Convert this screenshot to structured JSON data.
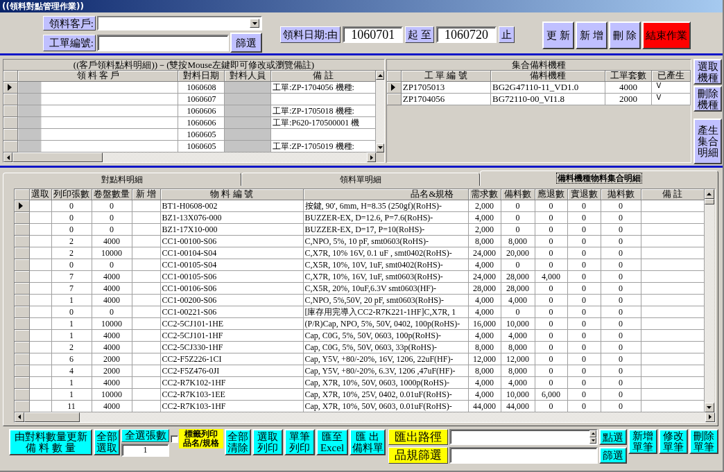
{
  "window": {
    "title": "((領料對點管理作業))"
  },
  "filters": {
    "customer": {
      "label": "領料客戶:"
    },
    "work_order": {
      "label": "工單編號:"
    },
    "filter_button": "篩選",
    "date_range": {
      "label": "領料日期:由",
      "from": "1060701",
      "between": "起 至",
      "to": "1060720",
      "end": "止"
    }
  },
  "toolbar": [
    {
      "label": "更 新",
      "kind": "normal"
    },
    {
      "label": "新 增",
      "kind": "normal"
    },
    {
      "label": "刪 除",
      "kind": "normal"
    },
    {
      "label": "結束作業",
      "kind": "danger"
    }
  ],
  "pick_table": {
    "title": "((客戶領料點料明細))－(雙按Mouse左鍵即可修改或瀏覽備註)",
    "columns": [
      "領 料 客 戶",
      "對料日期",
      "對料人員",
      "備 註"
    ],
    "rows": [
      {
        "selected": true,
        "masked": true,
        "date": "1060608",
        "remark": "工單:ZP-1704056 機種:"
      },
      {
        "selected": false,
        "masked": true,
        "date": "1060607"
      },
      {
        "selected": false,
        "masked": true,
        "date": "1060606",
        "remark": "工單:ZP-1705018 機種:"
      },
      {
        "selected": false,
        "masked": true,
        "date": "1060606",
        "remark": "工單:P620-170500001 機"
      },
      {
        "selected": false,
        "masked": true,
        "date": "1060605"
      },
      {
        "selected": false,
        "masked": true,
        "date": "1060605",
        "remark": "工單:ZP-1705019 機種:"
      }
    ]
  },
  "model_table": {
    "title": "集合備料機種",
    "columns": [
      "工 單 編 號",
      "備料機種",
      "工單套數",
      "已產生"
    ],
    "rows": [
      {
        "selected": true,
        "work_order": "ZP1705013",
        "model": "BG2G47110-11_VD1.0",
        "sets": "4000",
        "generated": "V"
      },
      {
        "selected": false,
        "work_order": "ZP1704056",
        "model": "BG72110-00_VI1.8",
        "sets": "2000",
        "generated": "V"
      }
    ]
  },
  "model_buttons": [
    "選取機種",
    "刪除機種",
    "產生集合明細"
  ],
  "tabs": [
    {
      "label": "對點料明細",
      "selected": false
    },
    {
      "label": "領料單明細",
      "selected": false
    },
    {
      "label": "備料機種物料集合明細",
      "selected": true
    }
  ],
  "detail_table": {
    "columns": [
      "選取",
      "列印張數",
      "卷盤數量",
      "新 增",
      "物 料 編 號",
      "品名&規格",
      "需求數",
      "備料數",
      "應退數",
      "實退數",
      "拋料數",
      "備 註"
    ],
    "rows": [
      {
        "selected": true,
        "print_count": "0",
        "reel_qty": "0",
        "part_no": "BT1-H0608-002",
        "name_spec": "按鍵, 90', 6mm, H=8.35 (250gf)(RoHS)-",
        "required": "2,000",
        "prepared": "0",
        "to_return": "0",
        "returned": "0",
        "scrapped": "0"
      },
      {
        "selected": false,
        "print_count": "0",
        "reel_qty": "0",
        "part_no": "BZ1-13X076-000",
        "name_spec": "BUZZER-EX, D=12.6, P=7.6(RoHS)-",
        "required": "4,000",
        "prepared": "0",
        "to_return": "0",
        "returned": "0",
        "scrapped": "0"
      },
      {
        "selected": false,
        "print_count": "0",
        "reel_qty": "0",
        "part_no": "BZ1-17X10-000",
        "name_spec": "BUZZER-EX, D=17, P=10(RoHS)-",
        "required": "2,000",
        "prepared": "0",
        "to_return": "0",
        "returned": "0",
        "scrapped": "0"
      },
      {
        "selected": false,
        "print_count": "2",
        "reel_qty": "4000",
        "part_no": "CC1-00100-S06",
        "name_spec": "C,NPO, 5%, 10 pF, smt0603(RoHS)-",
        "required": "8,000",
        "prepared": "8,000",
        "to_return": "0",
        "returned": "0",
        "scrapped": "0"
      },
      {
        "selected": false,
        "print_count": "2",
        "reel_qty": "10000",
        "part_no": "CC1-00104-S04",
        "name_spec": "C,X7R, 10% 16V, 0.1 uF , smt0402(RoHS)-",
        "required": "24,000",
        "prepared": "20,000",
        "to_return": "0",
        "returned": "0",
        "scrapped": "0"
      },
      {
        "selected": false,
        "print_count": "0",
        "reel_qty": "0",
        "part_no": "CC1-00105-S04",
        "name_spec": "C,X5R, 10%, 10V, 1uF, smt0402(RoHS)-",
        "required": "4,000",
        "prepared": "0",
        "to_return": "0",
        "returned": "0",
        "scrapped": "0"
      },
      {
        "selected": false,
        "print_count": "7",
        "reel_qty": "4000",
        "part_no": "CC1-00105-S06",
        "name_spec": "C,X7R, 10%, 16V, 1uF, smt0603(RoHS)-",
        "required": "24,000",
        "prepared": "28,000",
        "to_return": "4,000",
        "returned": "0",
        "scrapped": "0"
      },
      {
        "selected": false,
        "print_count": "7",
        "reel_qty": "4000",
        "part_no": "CC1-00106-S06",
        "name_spec": "C,X5R, 20%, 10uF,6.3V smt0603(HF)-",
        "required": "28,000",
        "prepared": "28,000",
        "to_return": "0",
        "returned": "0",
        "scrapped": "0"
      },
      {
        "selected": false,
        "print_count": "1",
        "reel_qty": "4000",
        "part_no": "CC1-00200-S06",
        "name_spec": "C,NPO, 5%,50V, 20 pF, smt0603(RoHS)-",
        "required": "4,000",
        "prepared": "4,000",
        "to_return": "0",
        "returned": "0",
        "scrapped": "0"
      },
      {
        "selected": false,
        "print_count": "0",
        "reel_qty": "0",
        "part_no": "CC1-00221-S06",
        "name_spec": "[庫存用完導入CC2-R7K221-1HF]C,X7R, 1",
        "required": "4,000",
        "prepared": "0",
        "to_return": "0",
        "returned": "0",
        "scrapped": "0"
      },
      {
        "selected": false,
        "print_count": "1",
        "reel_qty": "10000",
        "part_no": "CC2-5CJ101-1HE",
        "name_spec": "(P/R)Cap, NPO, 5%, 50V, 0402, 100p(RoHS)-",
        "required": "16,000",
        "prepared": "10,000",
        "to_return": "0",
        "returned": "0",
        "scrapped": "0"
      },
      {
        "selected": false,
        "print_count": "1",
        "reel_qty": "4000",
        "part_no": "CC2-5CJ101-1HF",
        "name_spec": "Cap, C0G, 5%, 50V, 0603, 100p(RoHS)-",
        "required": "4,000",
        "prepared": "4,000",
        "to_return": "0",
        "returned": "0",
        "scrapped": "0"
      },
      {
        "selected": false,
        "print_count": "2",
        "reel_qty": "4000",
        "part_no": "CC2-5CJ330-1HF",
        "name_spec": "Cap, C0G, 5%, 50V, 0603, 33p(RoHS)-",
        "required": "8,000",
        "prepared": "8,000",
        "to_return": "0",
        "returned": "0",
        "scrapped": "0"
      },
      {
        "selected": false,
        "print_count": "6",
        "reel_qty": "2000",
        "part_no": "CC2-F5Z226-1CI",
        "name_spec": "Cap, Y5V, +80/-20%, 16V, 1206, 22uF(HF)-",
        "required": "12,000",
        "prepared": "12,000",
        "to_return": "0",
        "returned": "0",
        "scrapped": "0"
      },
      {
        "selected": false,
        "print_count": "4",
        "reel_qty": "2000",
        "part_no": "CC2-F5Z476-0JI",
        "name_spec": "Cap, Y5V, +80/-20%, 6.3V, 1206 ,47uF(HF)-",
        "required": "8,000",
        "prepared": "8,000",
        "to_return": "0",
        "returned": "0",
        "scrapped": "0"
      },
      {
        "selected": false,
        "print_count": "1",
        "reel_qty": "4000",
        "part_no": "CC2-R7K102-1HF",
        "name_spec": "Cap, X7R, 10%, 50V, 0603, 1000p(RoHS)-",
        "required": "4,000",
        "prepared": "4,000",
        "to_return": "0",
        "returned": "0",
        "scrapped": "0"
      },
      {
        "selected": false,
        "print_count": "1",
        "reel_qty": "10000",
        "part_no": "CC2-R7K103-1EE",
        "name_spec": "Cap, X7R, 10%, 25V, 0402, 0.01uF(RoHS)-",
        "required": "4,000",
        "prepared": "10,000",
        "to_return": "6,000",
        "returned": "0",
        "scrapped": "0"
      },
      {
        "selected": false,
        "print_count": "11",
        "reel_qty": "4000",
        "part_no": "CC2-R7K103-1HF",
        "name_spec": "Cap, X7R, 10%, 50V, 0603, 0.01uF(RoHS)-",
        "required": "44,000",
        "prepared": "44,000",
        "to_return": "0",
        "returned": "0",
        "scrapped": "0"
      }
    ]
  },
  "bottom": {
    "left_controls": [
      {
        "kind": "button",
        "label": "由對料數量更新備 料 數 量"
      },
      {
        "kind": "button",
        "label": "全部選取"
      },
      {
        "kind": "count",
        "label": "全選張數",
        "value": "1"
      },
      {
        "kind": "checkbox",
        "label": "標籤列印品名/規格",
        "checked": false
      },
      {
        "kind": "button",
        "label": "全部清除"
      },
      {
        "kind": "button",
        "label": "選取列印"
      },
      {
        "kind": "button",
        "label": "單筆列印"
      },
      {
        "kind": "button",
        "label": "匯至Excel"
      },
      {
        "kind": "button",
        "label": "匯 出備料單"
      }
    ],
    "export_path": {
      "label": "匯出路徑",
      "button": "點選"
    },
    "spec_filter": {
      "label": "品規篩選",
      "button": "篩選"
    },
    "right_buttons": [
      "新增單筆",
      "修改單筆",
      "刪除單筆"
    ]
  }
}
